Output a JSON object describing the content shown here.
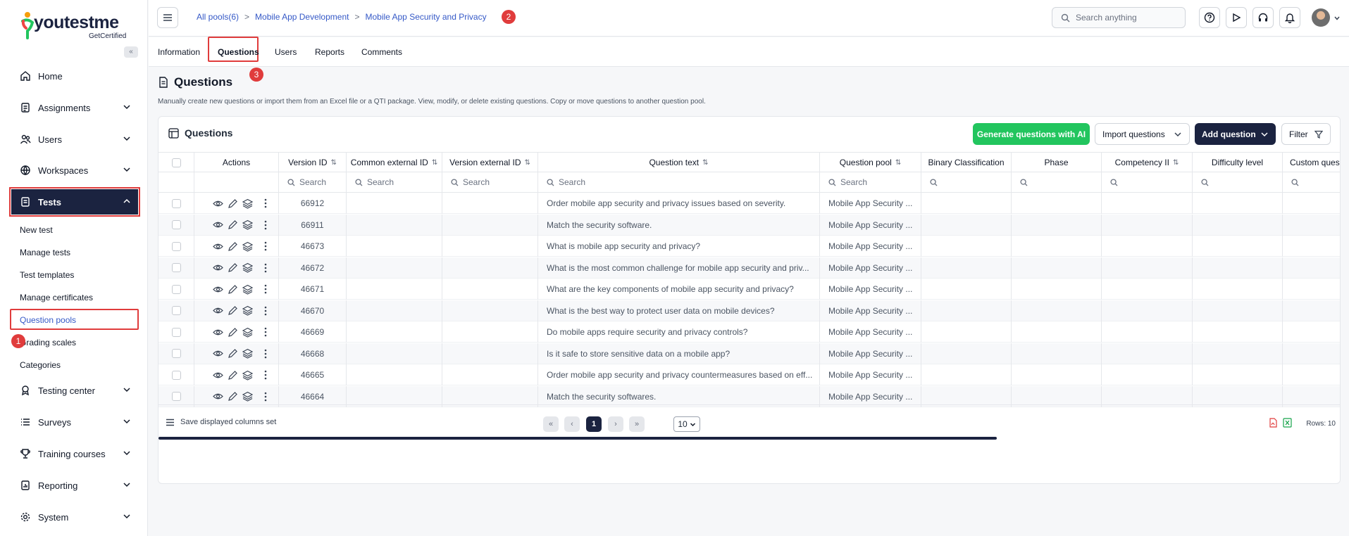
{
  "brand": {
    "name": "youtestme",
    "tagline": "GetCertified"
  },
  "sidebar": {
    "collapse_label": "«",
    "items": [
      {
        "label": "Home"
      },
      {
        "label": "Assignments"
      },
      {
        "label": "Users"
      },
      {
        "label": "Workspaces"
      },
      {
        "label": "Tests"
      },
      {
        "label": "Testing center"
      },
      {
        "label": "Surveys"
      },
      {
        "label": "Training courses"
      },
      {
        "label": "Reporting"
      },
      {
        "label": "System"
      }
    ],
    "tests_sub": [
      {
        "label": "New test"
      },
      {
        "label": "Manage tests"
      },
      {
        "label": "Test templates"
      },
      {
        "label": "Manage certificates"
      },
      {
        "label": "Question pools"
      },
      {
        "label": "Grading scales"
      },
      {
        "label": "Categories"
      }
    ]
  },
  "breadcrumbs": [
    "All pools(6)",
    "Mobile App Development",
    "Mobile App Security and Privacy"
  ],
  "breadcrumb_sep": ">",
  "search": {
    "placeholder": "Search anything"
  },
  "tabs": [
    "Information",
    "Questions",
    "Users",
    "Reports",
    "Comments"
  ],
  "annotations": [
    "1",
    "2",
    "3"
  ],
  "page": {
    "title": "Questions",
    "description": "Manually create new questions or import them from an Excel file or a QTI package. View, modify, or delete existing questions. Copy or move questions to another question pool."
  },
  "card": {
    "title": "Questions",
    "btn_ai": "Generate questions with AI",
    "btn_import": "Import questions",
    "btn_add": "Add question",
    "btn_filter": "Filter"
  },
  "table": {
    "columns": [
      "Actions",
      "Version ID",
      "Common external ID",
      "Version external ID",
      "Question text",
      "Question pool",
      "Binary Classification",
      "Phase",
      "Competency II",
      "Difficulty level",
      "Custom quest"
    ],
    "search_placeholder": "Search",
    "rows": [
      {
        "id": "66912",
        "text": "Order mobile app security and privacy issues based on severity.",
        "pool": "Mobile App Security ..."
      },
      {
        "id": "66911",
        "text": "Match the security software.",
        "pool": "Mobile App Security ..."
      },
      {
        "id": "46673",
        "text": "What is mobile app security and privacy?",
        "pool": "Mobile App Security ..."
      },
      {
        "id": "46672",
        "text": "What is the most common challenge for mobile app security and priv...",
        "pool": "Mobile App Security ..."
      },
      {
        "id": "46671",
        "text": "What are the key components of mobile app security and privacy?",
        "pool": "Mobile App Security ..."
      },
      {
        "id": "46670",
        "text": "What is the best way to protect user data on mobile devices?",
        "pool": "Mobile App Security ..."
      },
      {
        "id": "46669",
        "text": "Do mobile apps require security and privacy controls?",
        "pool": "Mobile App Security ..."
      },
      {
        "id": "46668",
        "text": "Is it safe to store sensitive data on a mobile app?",
        "pool": "Mobile App Security ..."
      },
      {
        "id": "46665",
        "text": "Order mobile app security and privacy countermeasures based on eff...",
        "pool": "Mobile App Security ..."
      },
      {
        "id": "46664",
        "text": "Match the security softwares.",
        "pool": "Mobile App Security ..."
      }
    ]
  },
  "footer": {
    "save_columns": "Save displayed columns set",
    "first": "«",
    "prev": "‹",
    "current_page": "1",
    "next": "›",
    "last": "»",
    "page_size": "10",
    "rows_label": "Rows: 10"
  },
  "colors": {
    "navy": "#1b2340",
    "accent_red": "#e03c3c",
    "green": "#22c55e",
    "link": "#3559c7"
  }
}
